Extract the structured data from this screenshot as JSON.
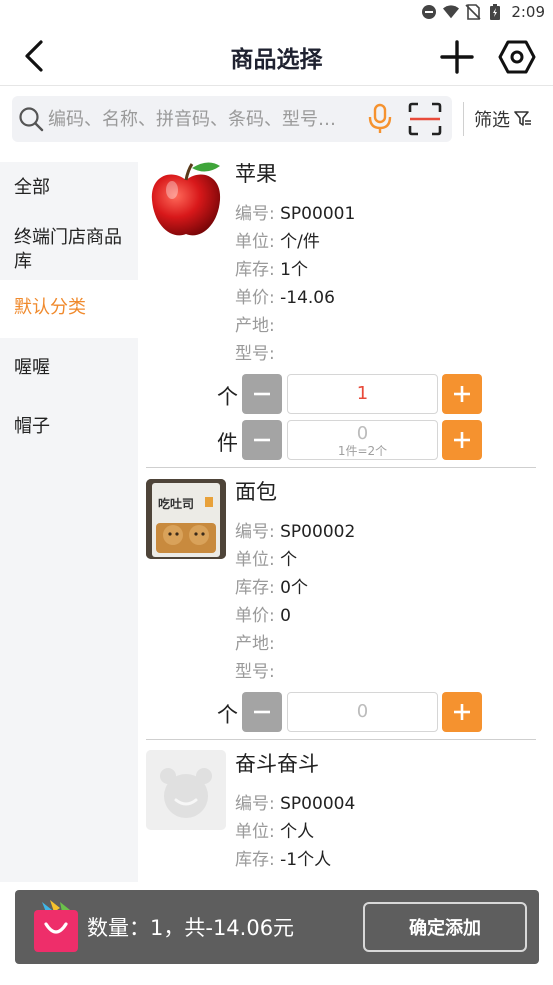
{
  "status_bar": {
    "time": "2:09",
    "icons": [
      "dnd-icon",
      "wifi-icon",
      "no-sim-icon",
      "battery-icon"
    ]
  },
  "header": {
    "title": "商品选择",
    "back_icon": "chevron-left-icon",
    "add_icon": "plus-icon",
    "settings_icon": "hexagon-settings-icon"
  },
  "search": {
    "placeholder": "编码、名称、拼音码、条码、型号…",
    "filter_label": "筛选"
  },
  "categories": [
    {
      "label": "全部",
      "active": false
    },
    {
      "label": "终端门店商品库",
      "active": false
    },
    {
      "label": "默认分类",
      "active": true
    },
    {
      "label": "喔喔",
      "active": false
    },
    {
      "label": "帽子",
      "active": false
    }
  ],
  "products": [
    {
      "name": "苹果",
      "attrs": [
        {
          "k": "编号:",
          "v": "SP00001"
        },
        {
          "k": "单位:",
          "v": "个/件"
        },
        {
          "k": "库存:",
          "v": "1个"
        },
        {
          "k": "单价:",
          "v": "-14.06"
        },
        {
          "k": "产地:",
          "v": ""
        },
        {
          "k": "型号:",
          "v": ""
        }
      ],
      "steppers": [
        {
          "unit": "个",
          "value": "1",
          "hint": ""
        },
        {
          "unit": "件",
          "value": "0",
          "hint": "1件=2个"
        }
      ]
    },
    {
      "name": "面包",
      "thumb_text": "吃吐司",
      "attrs": [
        {
          "k": "编号:",
          "v": "SP00002"
        },
        {
          "k": "单位:",
          "v": "个"
        },
        {
          "k": "库存:",
          "v": "0个"
        },
        {
          "k": "单价:",
          "v": "0"
        },
        {
          "k": "产地:",
          "v": ""
        },
        {
          "k": "型号:",
          "v": ""
        }
      ],
      "steppers": [
        {
          "unit": "个",
          "value": "0",
          "hint": ""
        }
      ]
    },
    {
      "name": "奋斗奋斗",
      "attrs": [
        {
          "k": "编号:",
          "v": "SP00004"
        },
        {
          "k": "单位:",
          "v": "个人"
        },
        {
          "k": "库存:",
          "v": "-1个人"
        }
      ],
      "steppers": []
    }
  ],
  "bottom": {
    "summary": "数量：1，共-14.06元",
    "confirm_label": "确定添加",
    "cart_icon": "shopping-bag-icon"
  },
  "colors": {
    "accent": "#f5922f",
    "active_category": "#f08a2d",
    "qty_active": "#e84a3a",
    "minus_button": "#a4a4a4",
    "bottom_bar": "#5e5e5e"
  }
}
